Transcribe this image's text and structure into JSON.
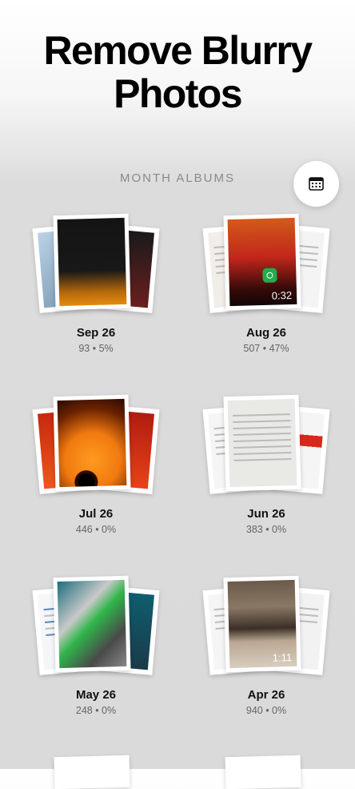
{
  "page": {
    "title": "Remove Blurry Photos"
  },
  "section_label": "MONTH ALBUMS",
  "calendar_button": {
    "icon": "calendar-icon"
  },
  "albums": [
    {
      "month": "Sep 26",
      "stats": "93 • 5%"
    },
    {
      "month": "Aug 26",
      "stats": "507 • 47%",
      "duration": "0:32"
    },
    {
      "month": "Jul 26",
      "stats": "446 • 0%"
    },
    {
      "month": "Jun 26",
      "stats": "383 • 0%"
    },
    {
      "month": "May 26",
      "stats": "248 • 0%"
    },
    {
      "month": "Apr 26",
      "stats": "940 • 0%",
      "duration": "1:11"
    }
  ]
}
